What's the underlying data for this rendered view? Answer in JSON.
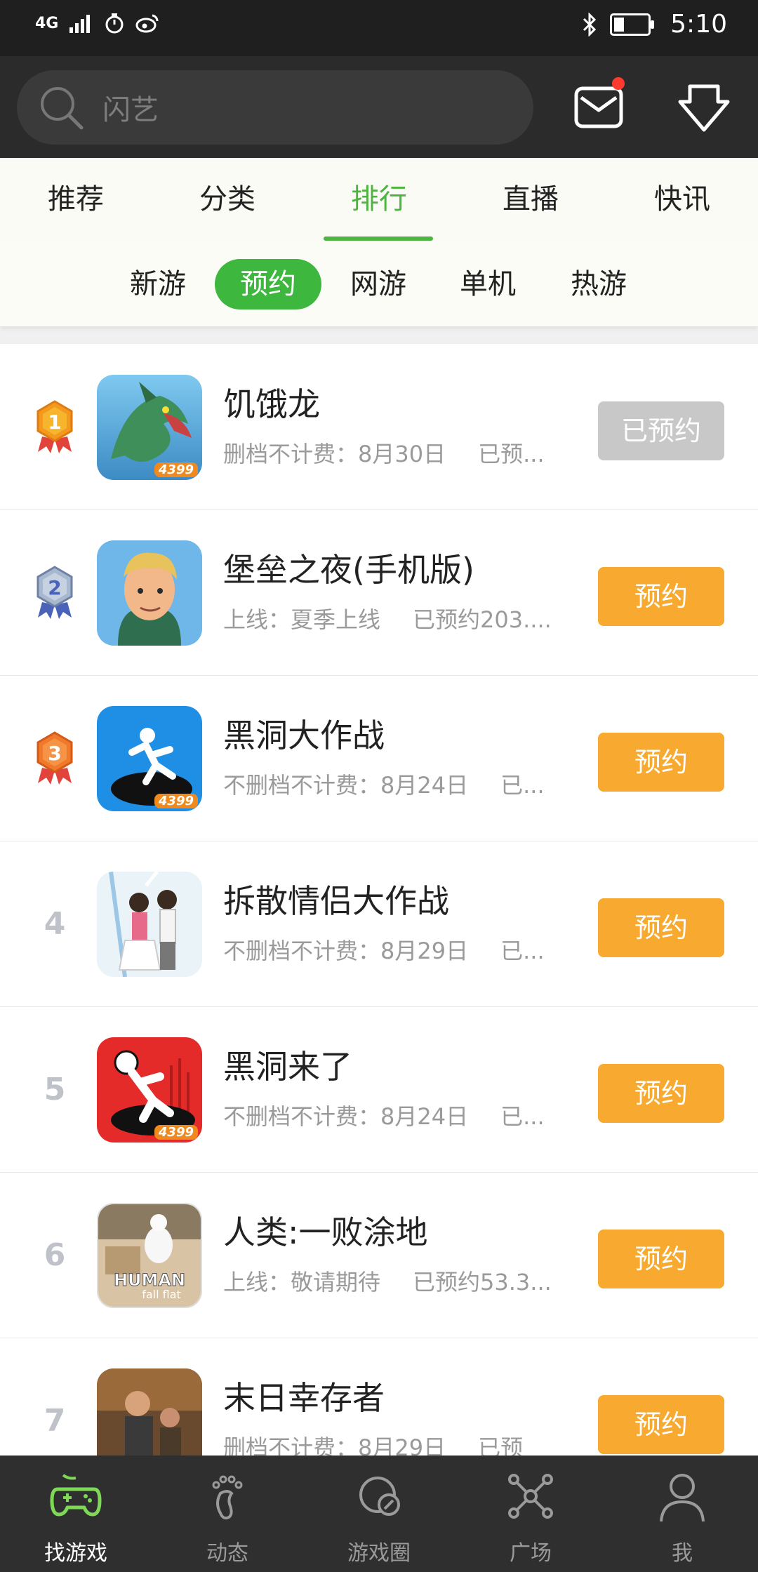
{
  "status_bar": {
    "network": "4G",
    "time": "5:10"
  },
  "search": {
    "placeholder": "闪艺"
  },
  "main_tabs": [
    "推荐",
    "分类",
    "排行",
    "直播",
    "快讯"
  ],
  "active_main_tab": "排行",
  "sub_tabs": [
    "新游",
    "预约",
    "网游",
    "单机",
    "热游"
  ],
  "active_sub_tab": "预约",
  "games": [
    {
      "rank": "1",
      "title": "饥饿龙",
      "meta1": "删档不计费：8月30日",
      "meta2": "已预...",
      "button": "已预约",
      "reserved": true
    },
    {
      "rank": "2",
      "title": "堡垒之夜(手机版)",
      "meta1": "上线：夏季上线",
      "meta2": "已预约203....",
      "button": "预约",
      "reserved": false
    },
    {
      "rank": "3",
      "title": "黑洞大作战",
      "meta1": "不删档不计费：8月24日",
      "meta2": "已...",
      "button": "预约",
      "reserved": false
    },
    {
      "rank": "4",
      "title": "拆散情侣大作战",
      "meta1": "不删档不计费：8月29日",
      "meta2": "已...",
      "button": "预约",
      "reserved": false
    },
    {
      "rank": "5",
      "title": "黑洞来了",
      "meta1": "不删档不计费：8月24日",
      "meta2": "已...",
      "button": "预约",
      "reserved": false
    },
    {
      "rank": "6",
      "title": "人类:一败涂地",
      "meta1": "上线：敬请期待",
      "meta2": "已预约53.3...",
      "button": "预约",
      "reserved": false
    },
    {
      "rank": "7",
      "title": "末日幸存者",
      "meta1": "删档不计费：8月29日",
      "meta2": "已预",
      "button": "预约",
      "reserved": false
    }
  ],
  "icon_badge": "4399",
  "human_logo": {
    "line1": "HUMAN",
    "line2": "fall flat"
  },
  "bottom_nav": [
    {
      "label": "找游戏",
      "active": true
    },
    {
      "label": "动态",
      "active": false
    },
    {
      "label": "游戏圈",
      "active": false
    },
    {
      "label": "广场",
      "active": false
    },
    {
      "label": "我",
      "active": false
    }
  ],
  "colors": {
    "accent_green": "#4cb43f",
    "reserve_orange": "#f7a930",
    "reserved_gray": "#c8c8c8"
  }
}
